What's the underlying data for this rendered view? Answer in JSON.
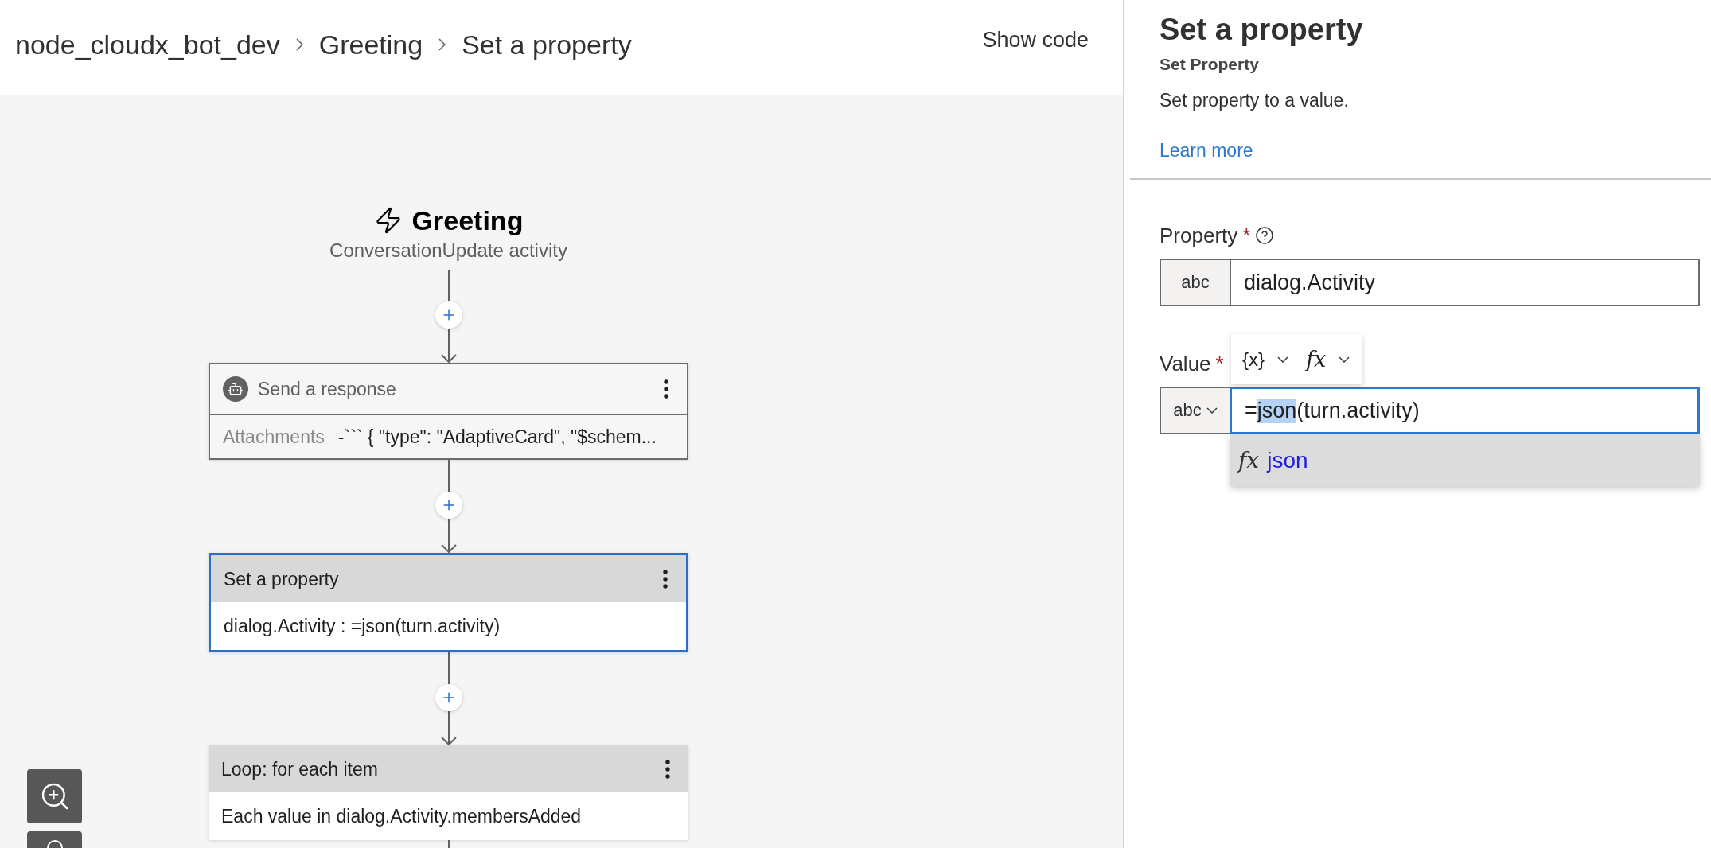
{
  "breadcrumb": [
    {
      "label": "node_cloudx_bot_dev"
    },
    {
      "label": "Greeting"
    },
    {
      "label": "Set a property"
    }
  ],
  "show_code": "Show code",
  "trigger": {
    "title": "Greeting",
    "subtitle": "ConversationUpdate activity"
  },
  "nodes": [
    {
      "kind": "response",
      "title": "Send a response",
      "field_label": "Attachments",
      "field_value": "-``` { \"type\": \"AdaptiveCard\", \"$schem...",
      "selected": false
    },
    {
      "kind": "action",
      "title": "Set a property",
      "body": "dialog.Activity : =json(turn.activity)",
      "selected": true
    },
    {
      "kind": "action",
      "title": "Loop: for each item",
      "body": "Each value in dialog.Activity.membersAdded",
      "selected": false
    }
  ],
  "panel": {
    "title": "Set a property",
    "subtitle": "Set Property",
    "description": "Set property to a value.",
    "link": "Learn more",
    "fields": [
      {
        "label": "Property",
        "required_mark": "*",
        "help": true,
        "type": {
          "label": "abc",
          "dropdown": false
        },
        "focused": false,
        "value_parts": [
          {
            "text": "dialog.Activity",
            "selected": false
          }
        ]
      },
      {
        "label": "Value",
        "required_mark": "*",
        "help": false,
        "type": {
          "label": "abc",
          "dropdown": true
        },
        "focused": true,
        "value_parts": [
          {
            "text": "=",
            "selected": false
          },
          {
            "text": "json",
            "selected": true
          },
          {
            "text": "(turn.activity)",
            "selected": false
          }
        ],
        "toolbar": [
          {
            "label": "{x}",
            "kind": "plain"
          },
          {
            "label": "fx",
            "kind": "formula"
          }
        ],
        "suggestions": [
          {
            "prefix": "fx",
            "label": "json",
            "selected": true
          }
        ]
      }
    ]
  }
}
